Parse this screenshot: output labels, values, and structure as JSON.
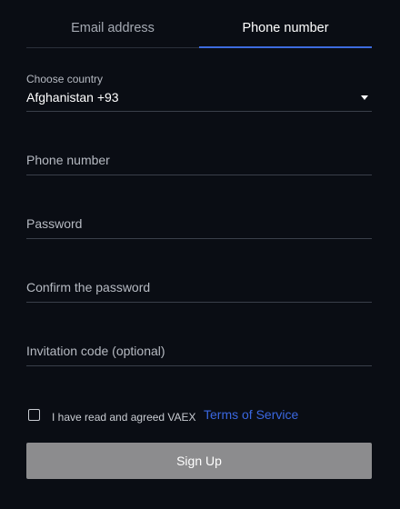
{
  "tabs": [
    {
      "label": "Email address",
      "active": false
    },
    {
      "label": "Phone number",
      "active": true
    }
  ],
  "country": {
    "label": "Choose country",
    "value": "Afghanistan +93"
  },
  "fields": {
    "phone_placeholder": "Phone number",
    "password_placeholder": "Password",
    "confirm_placeholder": "Confirm the password",
    "invitation_placeholder": "Invitation code (optional)"
  },
  "agreement": {
    "text": "I have read and agreed VAEX",
    "link": "Terms of Service",
    "checked": false
  },
  "signup_label": "Sign Up",
  "colors": {
    "background": "#0a0d14",
    "accent": "#3d6bde",
    "button": "#8c8c8e"
  }
}
